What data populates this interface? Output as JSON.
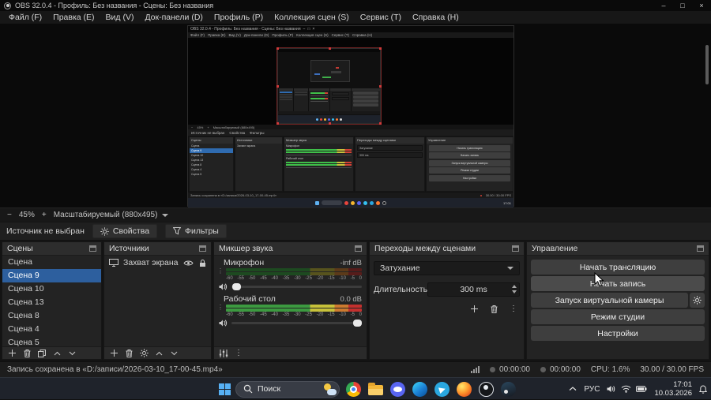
{
  "window": {
    "title": "OBS 32.0.4 - Профиль: Без названия - Сцены: Без названия",
    "minimize": "–",
    "maximize": "□",
    "close": "×",
    "menus": [
      "Файл (F)",
      "Правка (E)",
      "Вид (V)",
      "Док-панели (D)",
      "Профиль (P)",
      "Коллекция сцен (S)",
      "Сервис (T)",
      "Справка (H)"
    ]
  },
  "preview": {
    "zoom_out": "−",
    "zoom_value": "45%",
    "zoom_in": "+",
    "canvas_mode": "Масштабируемый (880x495)"
  },
  "source_row": {
    "message": "Источник не выбран",
    "properties": "Свойства",
    "filters": "Фильтры"
  },
  "panels": {
    "scenes": {
      "title": "Сцены",
      "items": [
        "Сцена",
        "Сцена 9",
        "Сцена 10",
        "Сцена 13",
        "Сцена 8",
        "Сцена 4",
        "Сцена 5"
      ]
    },
    "sources": {
      "title": "Источники",
      "item": "Захват экрана"
    },
    "mixer": {
      "title": "Микшер звука",
      "ch1_name": "Микрофон",
      "ch1_level": "-inf dB",
      "ch2_name": "Рабочий стол",
      "ch2_level": "0.0 dB",
      "scale": [
        "-60",
        "-55",
        "-50",
        "-45",
        "-40",
        "-35",
        "-30",
        "-25",
        "-20",
        "-15",
        "-10",
        "-5",
        "0"
      ]
    },
    "transitions": {
      "title": "Переходы между сценами",
      "value": "Затухание",
      "duration_label": "Длительность",
      "duration": "300 ms"
    },
    "controls": {
      "title": "Управление",
      "stream": "Начать трансляцию",
      "record": "Начать запись",
      "vcam": "Запуск виртуальной камеры",
      "studio": "Режим студии",
      "settings": "Настройки"
    }
  },
  "statusbar": {
    "message": "Запись сохранена в «D:/записи/2026-03-10_17-00-45.mp4»",
    "stream_time": "00:00:00",
    "rec_time": "00:00:00",
    "cpu": "CPU: 1.6%",
    "fps": "30.00 / 30.00 FPS"
  },
  "taskbar": {
    "search": "Поиск",
    "lang": "РУС",
    "time": "17:01",
    "date": "10.03.2026"
  }
}
